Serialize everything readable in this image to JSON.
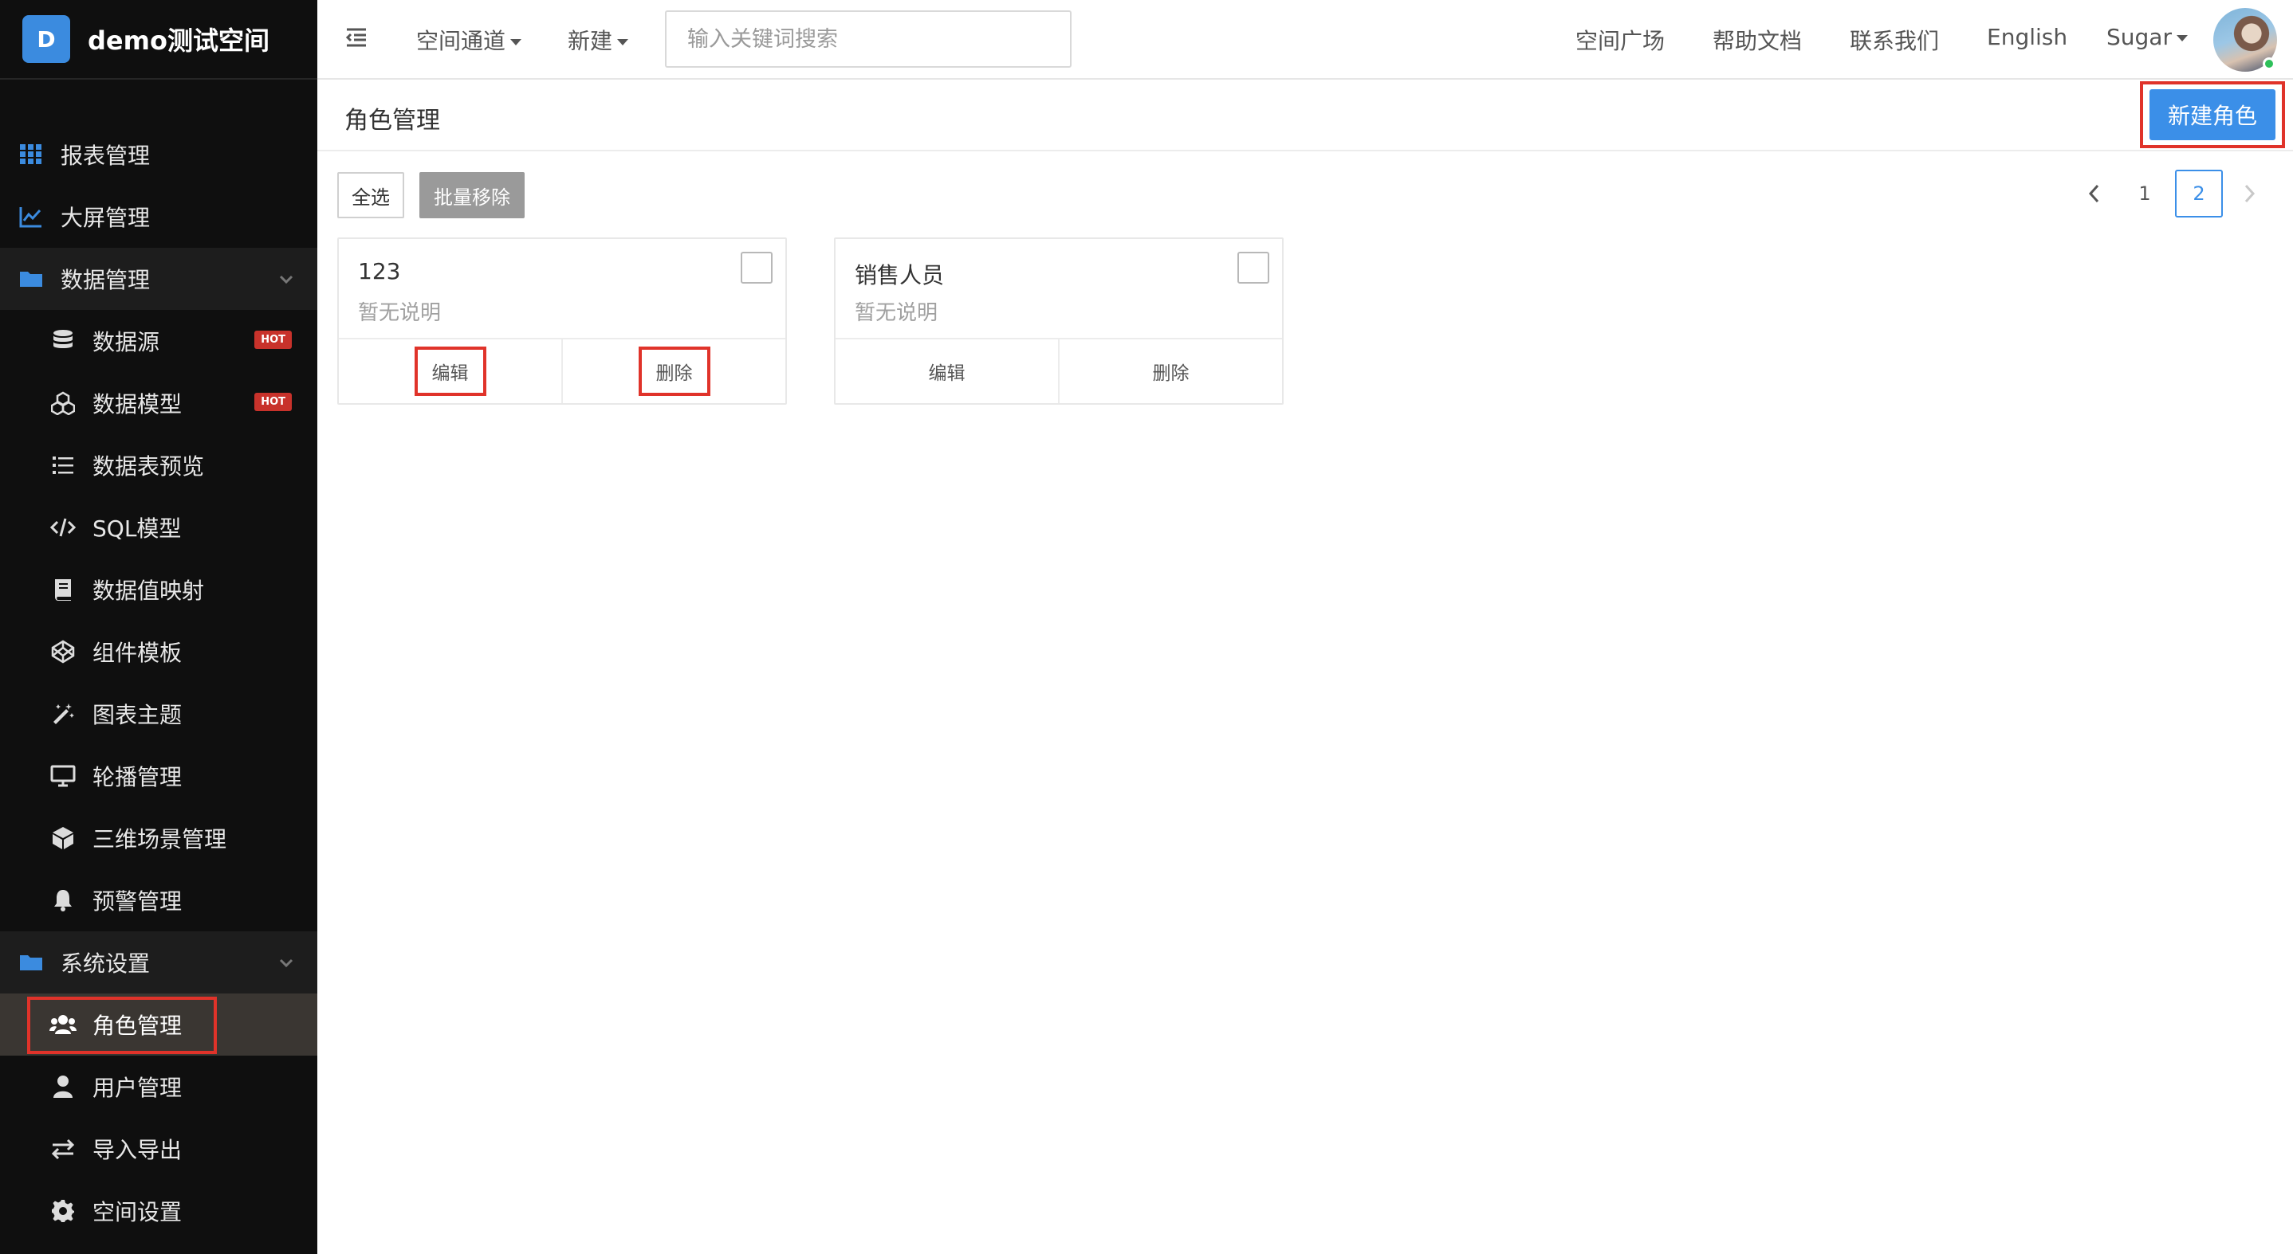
{
  "app": {
    "badge": "D",
    "space_name": "demo测试空间"
  },
  "sidebar": {
    "items": [
      {
        "type": "group",
        "label": "报表管理",
        "icon": "grid-icon"
      },
      {
        "type": "group",
        "label": "大屏管理",
        "icon": "line-chart-icon"
      },
      {
        "type": "group",
        "label": "数据管理",
        "icon": "folder-icon",
        "expandable": true
      },
      {
        "type": "sub",
        "label": "数据源",
        "icon": "database-icon",
        "badge": "HOT"
      },
      {
        "type": "sub",
        "label": "数据模型",
        "icon": "cubes-icon",
        "badge": "HOT"
      },
      {
        "type": "sub",
        "label": "数据表预览",
        "icon": "list-icon"
      },
      {
        "type": "sub",
        "label": "SQL模型",
        "icon": "code-icon"
      },
      {
        "type": "sub",
        "label": "数据值映射",
        "icon": "book-icon"
      },
      {
        "type": "sub",
        "label": "组件模板",
        "icon": "codepen-icon"
      },
      {
        "type": "sub",
        "label": "图表主题",
        "icon": "magic-wand-icon"
      },
      {
        "type": "sub",
        "label": "轮播管理",
        "icon": "monitor-icon"
      },
      {
        "type": "sub",
        "label": "三维场景管理",
        "icon": "cube-icon"
      },
      {
        "type": "sub",
        "label": "预警管理",
        "icon": "bell-icon"
      },
      {
        "type": "group",
        "label": "系统设置",
        "icon": "folder-icon",
        "expandable": true
      },
      {
        "type": "sub",
        "label": "角色管理",
        "icon": "users-icon",
        "active": true
      },
      {
        "type": "sub",
        "label": "用户管理",
        "icon": "user-icon"
      },
      {
        "type": "sub",
        "label": "导入导出",
        "icon": "exchange-icon"
      },
      {
        "type": "sub",
        "label": "空间设置",
        "icon": "gear-icon"
      }
    ]
  },
  "topbar": {
    "space_channel": "空间通道",
    "new": "新建",
    "search_placeholder": "输入关键词搜索",
    "links": [
      "空间广场",
      "帮助文档",
      "联系我们",
      "English"
    ],
    "user": "Sugar"
  },
  "page": {
    "title": "角色管理",
    "new_role_button": "新建角色",
    "select_all": "全选",
    "batch_remove": "批量移除"
  },
  "pagination": {
    "pages": [
      "1",
      "2"
    ],
    "current": "2"
  },
  "roles": [
    {
      "name": "123",
      "description": "暂无说明",
      "edit": "编辑",
      "delete": "删除"
    },
    {
      "name": "销售人员",
      "description": "暂无说明",
      "edit": "编辑",
      "delete": "删除"
    }
  ],
  "colors": {
    "accent": "#3b8fe8",
    "highlight": "#e0332a",
    "sidebar_bg": "#0f0f0f",
    "hot_badge": "#c8322b"
  }
}
